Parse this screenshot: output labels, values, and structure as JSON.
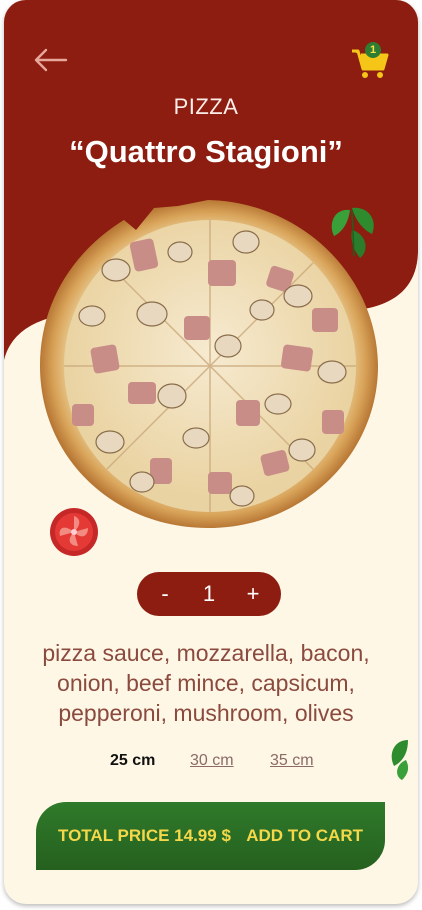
{
  "header": {
    "category": "PIZZA",
    "title": "“Quattro Stagioni”",
    "cart_count": "1"
  },
  "quantity": {
    "minus_label": "-",
    "value": "1",
    "plus_label": "+"
  },
  "ingredients_text": "pizza sauce, mozzarella, bacon, onion, beef mince, capsicum, pepperoni, mushroom, olives",
  "sizes": [
    {
      "label": "25 cm",
      "selected": true
    },
    {
      "label": "30 cm",
      "selected": false
    },
    {
      "label": "35 cm",
      "selected": false
    }
  ],
  "cta": {
    "price_label": "TOTAL PRICE 14.99 $",
    "add_label": "ADD TO CART"
  },
  "colors": {
    "header_red": "#8c1d10",
    "background_cream": "#fef7e6",
    "cta_green": "#2f7a2a",
    "cta_text": "#f5d84a",
    "ingredient_text": "#8b4a3e"
  },
  "icons": [
    "back-arrow-icon",
    "shopping-cart-icon",
    "basil-leaf-icon",
    "tomato-slice-icon"
  ]
}
